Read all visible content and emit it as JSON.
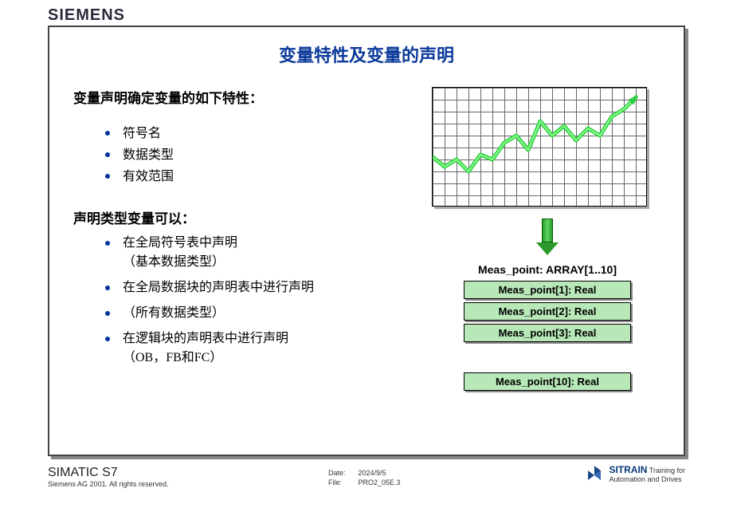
{
  "brand": "SIEMENS",
  "title": "变量特性及变量的声明",
  "left": {
    "intro1": "变量声明确定变量的如下特性：",
    "bullets1": [
      "符号名",
      "数据类型",
      "有效范围"
    ],
    "intro2": "声明类型变量可以：",
    "bullets2": [
      {
        "main": "在全局符号表中声明",
        "sub": "（基本数据类型）"
      },
      {
        "main": "在全局数据块的声明表中进行声明",
        "sub": ""
      },
      {
        "main": "（所有数据类型）",
        "sub": ""
      },
      {
        "main": "在逻辑块的声明表中进行声明",
        "sub": "（OB，FB和FC）"
      }
    ]
  },
  "right": {
    "array_label": "Meas_point: ARRAY[1..10]",
    "cells_top": [
      "Meas_point[1]:  Real",
      "Meas_point[2]:  Real",
      "Meas_point[3]:  Real"
    ],
    "cell_last": "Meas_point[10]: Real"
  },
  "chart_data": {
    "type": "line",
    "x": [
      0,
      1,
      2,
      3,
      4,
      5,
      6,
      7,
      8,
      9,
      10,
      11,
      12,
      13,
      14,
      15,
      16,
      17
    ],
    "y": [
      4.2,
      3.4,
      4.0,
      3.0,
      4.4,
      4.0,
      5.4,
      6.0,
      4.8,
      7.2,
      6.0,
      6.8,
      5.6,
      6.6,
      6.0,
      7.6,
      8.2,
      9.2
    ],
    "xlim": [
      0,
      18
    ],
    "ylim": [
      0,
      10
    ],
    "grid": true,
    "line_color": "#2ecc40",
    "title": "",
    "xlabel": "",
    "ylabel": ""
  },
  "footer": {
    "product": "SIMATIC S7",
    "copyright": "Siemens AG 2001. All rights reserved.",
    "date_label": "Date:",
    "date_value": "2024/9/5",
    "file_label": "File:",
    "file_value": "PRO2_05E.3",
    "sitrain_bold": "SITRAIN",
    "sitrain_rest": " Training for",
    "sitrain_line2": "Automation and Drives"
  }
}
